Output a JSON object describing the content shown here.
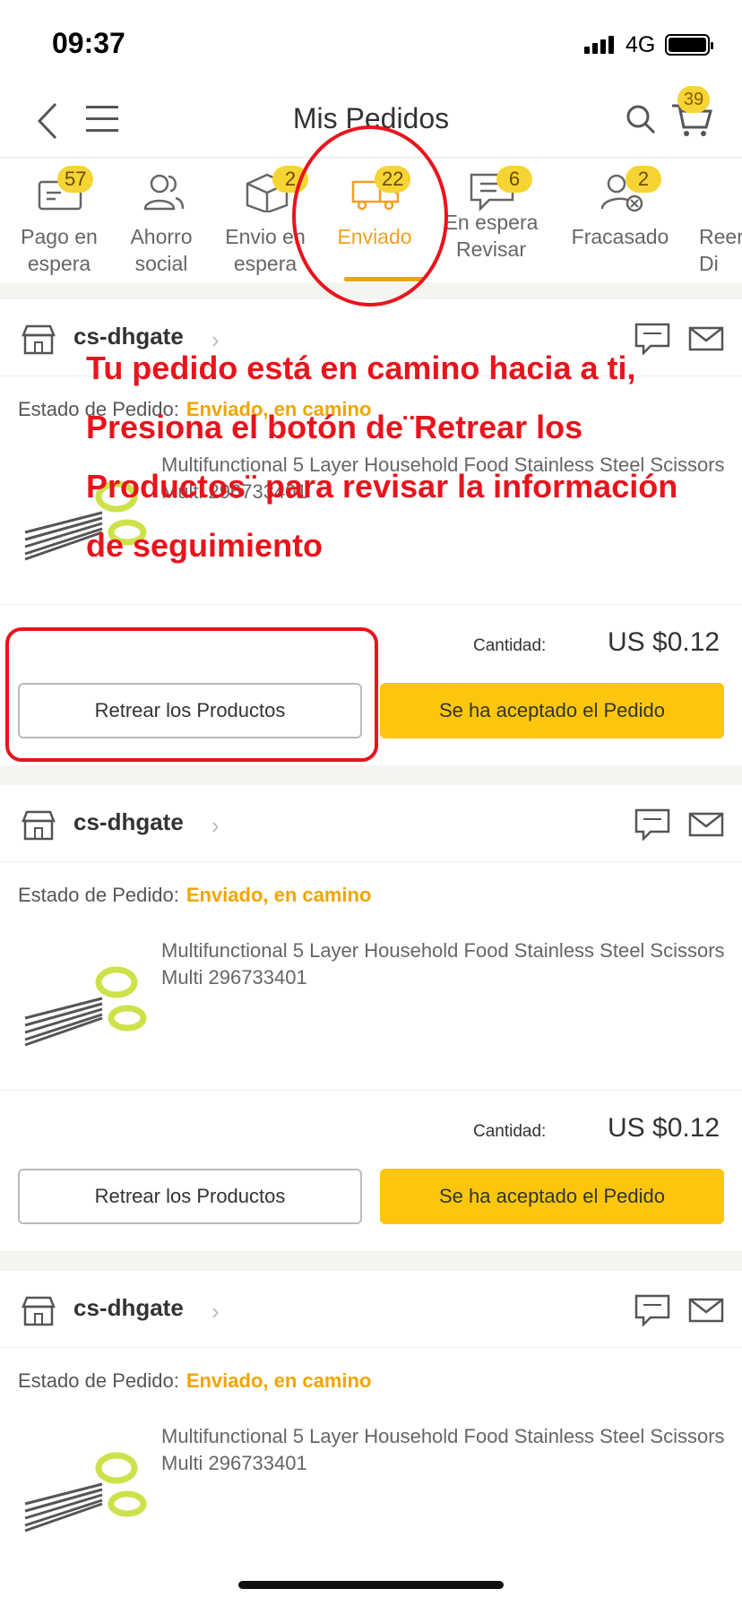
{
  "status_bar": {
    "time": "09:37",
    "network": "4G"
  },
  "nav": {
    "title": "Mis Pedidos",
    "cart_count": "39"
  },
  "tabs": [
    {
      "label": "Pago en\nespera",
      "badge": "57",
      "icon": "wallet-icon"
    },
    {
      "label": "Ahorro\nsocial",
      "badge": "",
      "icon": "group-icon"
    },
    {
      "label": "Envio en\nespera",
      "badge": "2",
      "icon": "box-icon"
    },
    {
      "label": "Enviado",
      "badge": "22",
      "icon": "truck-icon",
      "active": true
    },
    {
      "label": "En espera\nRevisar",
      "badge": "6",
      "icon": "review-icon"
    },
    {
      "label": "Fracasado",
      "badge": "2",
      "icon": "failed-user-icon"
    },
    {
      "label": "Reem\nDi",
      "badge": "",
      "icon": ""
    }
  ],
  "orders": [
    {
      "store": "cs-dhgate",
      "status_label": "Estado de Pedido:",
      "status_value": "Enviado, en camino",
      "product": "Multifunctional 5 Layer Household Food Stainless Steel Scissors Multi 296733401",
      "qty_label": "Cantidad:",
      "price": "US $0.12",
      "btn_track": "Retrear los Productos",
      "btn_accept": "Se ha aceptado el Pedido"
    },
    {
      "store": "cs-dhgate",
      "status_label": "Estado de Pedido:",
      "status_value": "Enviado, en camino",
      "product": "Multifunctional 5 Layer Household Food Stainless Steel Scissors Multi 296733401",
      "qty_label": "Cantidad:",
      "price": "US $0.12",
      "btn_track": "Retrear los Productos",
      "btn_accept": "Se ha aceptado el Pedido"
    },
    {
      "store": "cs-dhgate",
      "status_label": "Estado de Pedido:",
      "status_value": "Enviado, en camino",
      "product": "Multifunctional 5 Layer Household Food Stainless Steel Scissors Multi 296733401"
    }
  ],
  "annotation": {
    "lines": [
      "Tu pedido está en camino hacia a ti,",
      "Presiona el botón de¨Retrear los",
      "Productos¨ para revisar la información",
      "de seguimiento"
    ],
    "color": "#e8141c"
  },
  "colors": {
    "accent": "#f0a020",
    "button_yellow": "#fbc60b",
    "badge": "#f6d433"
  }
}
